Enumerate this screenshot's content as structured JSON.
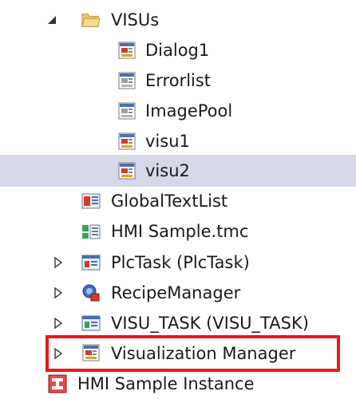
{
  "tree": {
    "items": [
      {
        "label": "VISUs",
        "icon": "folder-open-icon",
        "expanded": true
      },
      {
        "label": "Dialog1",
        "icon": "visu-red-icon"
      },
      {
        "label": "Errorlist",
        "icon": "visu-gray-icon"
      },
      {
        "label": "ImagePool",
        "icon": "visu-gray-icon"
      },
      {
        "label": "visu1",
        "icon": "visu-red-icon"
      },
      {
        "label": "visu2",
        "icon": "visu-red-icon",
        "selected": true
      },
      {
        "label": "GlobalTextList",
        "icon": "textlist-icon"
      },
      {
        "label": "HMI Sample.tmc",
        "icon": "tmc-icon"
      },
      {
        "label": "PlcTask (PlcTask)",
        "icon": "task-icon",
        "expanded": false
      },
      {
        "label": "RecipeManager",
        "icon": "recipe-icon",
        "expanded": false
      },
      {
        "label": "VISU_TASK (VISU_TASK)",
        "icon": "task-icon",
        "expanded": false
      },
      {
        "label": "Visualization Manager",
        "icon": "visu-manager-icon",
        "expanded": false,
        "highlighted": true
      },
      {
        "label": "HMI Sample Instance",
        "icon": "instance-icon"
      }
    ]
  },
  "colors": {
    "selection": "#d5d8e6",
    "highlight_border": "#e8191f"
  }
}
